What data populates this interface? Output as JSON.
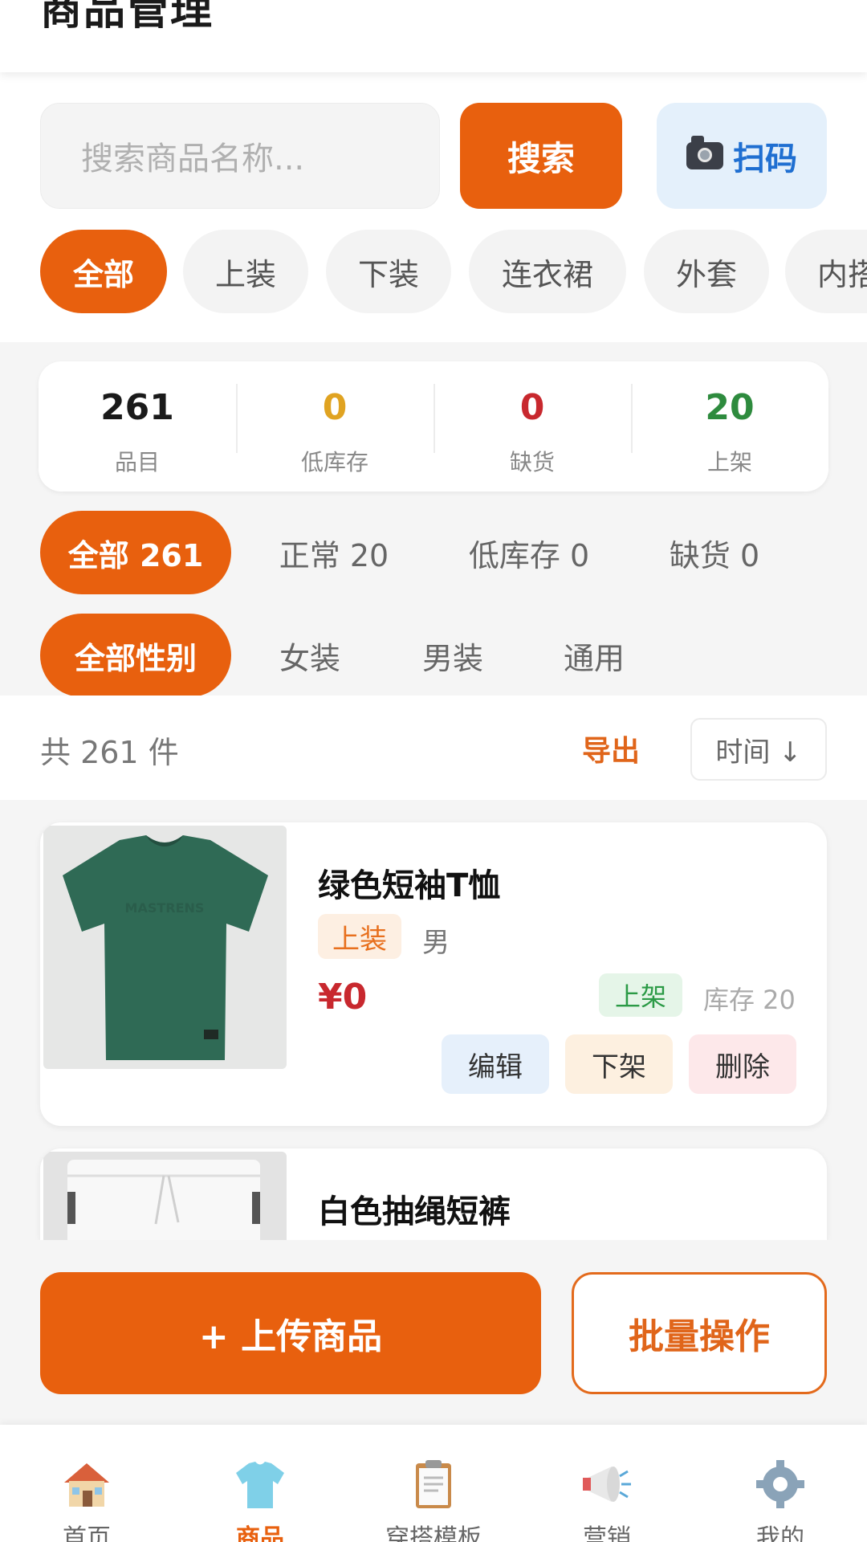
{
  "header": {
    "title": "商品管理"
  },
  "search": {
    "placeholder": "搜索商品名称...",
    "button": "搜索",
    "scan": "扫码"
  },
  "categories": [
    "全部",
    "上装",
    "下装",
    "连衣裙",
    "外套",
    "内搭"
  ],
  "stats": [
    {
      "value": "261",
      "label": "品目",
      "color": "#1a1a1a"
    },
    {
      "value": "0",
      "label": "低库存",
      "color": "#e0a321"
    },
    {
      "value": "0",
      "label": "缺货",
      "color": "#c8282e"
    },
    {
      "value": "20",
      "label": "上架",
      "color": "#2e8b3e"
    }
  ],
  "stock_filters": [
    "全部 261",
    "正常 20",
    "低库存 0",
    "缺货 0"
  ],
  "gender_filters": [
    "全部性别",
    "女装",
    "男装",
    "通用"
  ],
  "list": {
    "count": "共 261 件",
    "export": "导出",
    "sort": "时间 ↓"
  },
  "products": [
    {
      "name": "绿色短袖T恤",
      "tag": "上装",
      "gender": "男",
      "price": "¥0",
      "status": "上架",
      "stock": "库存 20",
      "actions": [
        "编辑",
        "下架",
        "删除"
      ]
    },
    {
      "name": "白色抽绳短裤"
    }
  ],
  "bottom": {
    "upload": "+ 上传商品",
    "batch": "批量操作"
  },
  "tabs": [
    {
      "label": "首页",
      "icon": "home-icon"
    },
    {
      "label": "商品",
      "icon": "tshirt-icon"
    },
    {
      "label": "穿搭模板",
      "icon": "clipboard-icon"
    },
    {
      "label": "营销",
      "icon": "megaphone-icon"
    },
    {
      "label": "我的",
      "icon": "gear-icon"
    }
  ],
  "colors": {
    "accent": "#e8600e",
    "price": "#c8282e",
    "status_green": "#2b9a46"
  }
}
